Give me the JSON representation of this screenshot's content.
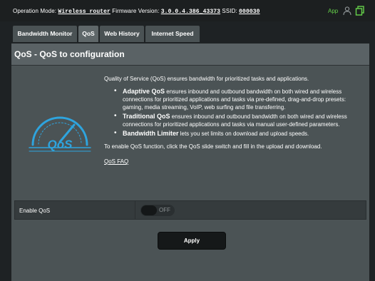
{
  "topbar": {
    "operation_mode_label": "Operation Mode:",
    "operation_mode_value": "Wireless router",
    "firmware_label": "Firmware Version:",
    "firmware_value": "3.0.0.4.386_43373",
    "ssid_label": "SSID:",
    "ssid_value": "000030",
    "app_label": "App",
    "icons": [
      "user-icon",
      "copy-icon"
    ],
    "app_color": "#66d34a"
  },
  "tabs": [
    {
      "label": "Bandwidth Monitor",
      "active": false
    },
    {
      "label": "QoS",
      "active": true
    },
    {
      "label": "Web History",
      "active": false
    },
    {
      "label": "Internet Speed",
      "active": false
    }
  ],
  "panel": {
    "title": "QoS - QoS to configuration",
    "intro": "Quality of Service (QoS) ensures bandwidth for prioritized tasks and applications.",
    "bullets": [
      {
        "term": "Adaptive QoS",
        "text": " ensures inbound and outbound bandwidth on both wired and wireless connections for prioritized applications and tasks via pre-defined, drag-and-drop presets: gaming, media streaming, VoIP, web surfing and file transferring."
      },
      {
        "term": "Traditional QoS",
        "text": " ensures inbound and outbound bandwidth on both wired and wireless connections for prioritized applications and tasks via manual user-defined parameters."
      },
      {
        "term": "Bandwidth Limiter",
        "text": " lets you set limits on download and upload speeds."
      }
    ],
    "enable_note": "To enable QoS function, click the QoS slide switch and fill in the upload and download.",
    "faq_link": "QoS FAQ",
    "logo_text": "QoS",
    "enable_label": "Enable QoS",
    "toggle_state": "OFF",
    "apply_label": "Apply"
  }
}
